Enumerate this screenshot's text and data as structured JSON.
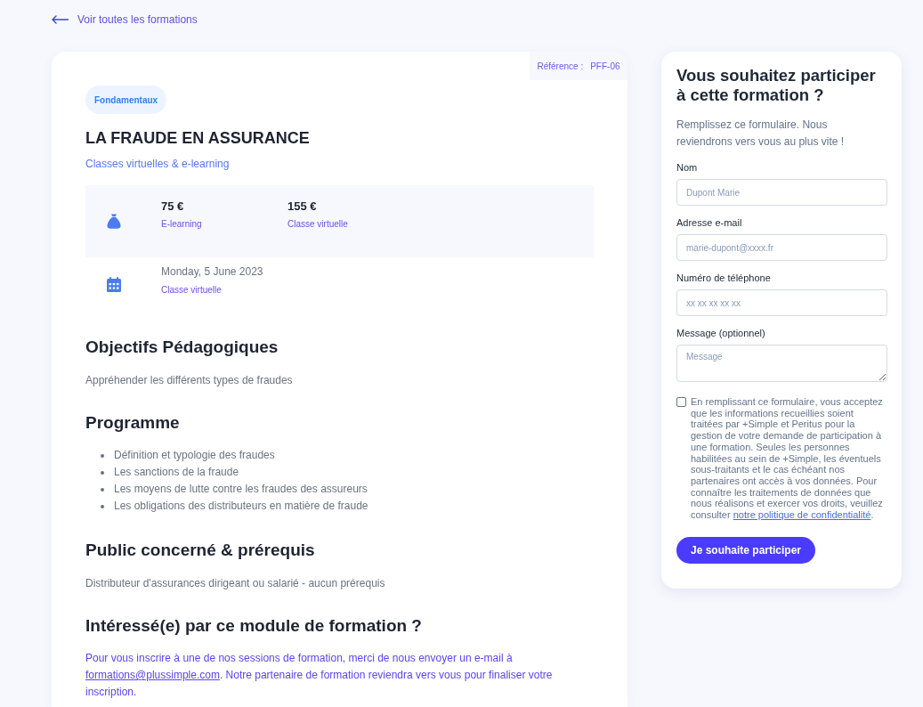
{
  "back_link": {
    "label": "Voir toutes les formations"
  },
  "course": {
    "reference": {
      "label": "Référence :",
      "value": "PFF-06"
    },
    "badge": "Fondamentaux",
    "title": "LA FRAUDE EN ASSURANCE",
    "subtitle": "Classes virtuelles & e-learning",
    "prices": [
      {
        "amount": "75 €",
        "mode": "E-learning"
      },
      {
        "amount": "155 €",
        "mode": "Classe virtuelle"
      }
    ],
    "session": {
      "date": "Monday, 5 June 2023",
      "mode": "Classe virtuelle"
    },
    "sections": [
      {
        "kind": "paragraph",
        "heading": "Objectifs Pédagogiques",
        "text": "Appréhender les différents types de fraudes"
      },
      {
        "kind": "list",
        "heading": "Programme",
        "items": [
          "Définition et typologie des fraudes",
          "Les sanctions de la fraude",
          "Les moyens de lutte contre les fraudes des assureurs",
          "Les obligations des distributeurs en matière de fraude"
        ]
      },
      {
        "kind": "paragraph",
        "heading": "Public concerné & prérequis",
        "text": "Distributeur d'assurances dirigeant ou salarié - aucun prérequis"
      },
      {
        "kind": "contact",
        "heading": "Intéressé(e) par ce module de formation ?",
        "text": "Pour vous inscrire à une de nos sessions de formation, merci de nous envoyer un e-mail à",
        "link": "formations@plussimple.com",
        "text_after": ". Notre partenaire de formation reviendra vers vous pour finaliser votre inscription."
      }
    ]
  },
  "form": {
    "title": "Vous souhaitez participer à cette formation ?",
    "intro": "Remplissez ce formulaire. Nous reviendrons vers vous au plus vite !",
    "fields": [
      {
        "kind": "input",
        "label": "Nom",
        "placeholder": "Dupont Marie"
      },
      {
        "kind": "input",
        "label": "Adresse e-mail",
        "placeholder": "marie-dupont@xxxx.fr"
      },
      {
        "kind": "input",
        "label": "Numéro de téléphone",
        "placeholder": "xx xx xx xx xx"
      },
      {
        "kind": "textarea",
        "label": "Message (optionnel)",
        "placeholder": "Message"
      }
    ],
    "consent": {
      "checked": false,
      "text": "En remplissant ce formulaire, vous acceptez que les informations recueillies soient traitées par +Simple et Peritus pour la gestion de votre demande de participation à une formation. Seules les personnes habilitées au sein de +Simple, les éventuels sous-traitants et le cas échéant nos partenaires ont accès à vos données. Pour connaître les traitements de données que nous réalisons et exercer vos droits, veuillez consulter",
      "link": "notre politique de confidentialité",
      "text_after": "."
    },
    "submit": "Je souhaite participer"
  }
}
